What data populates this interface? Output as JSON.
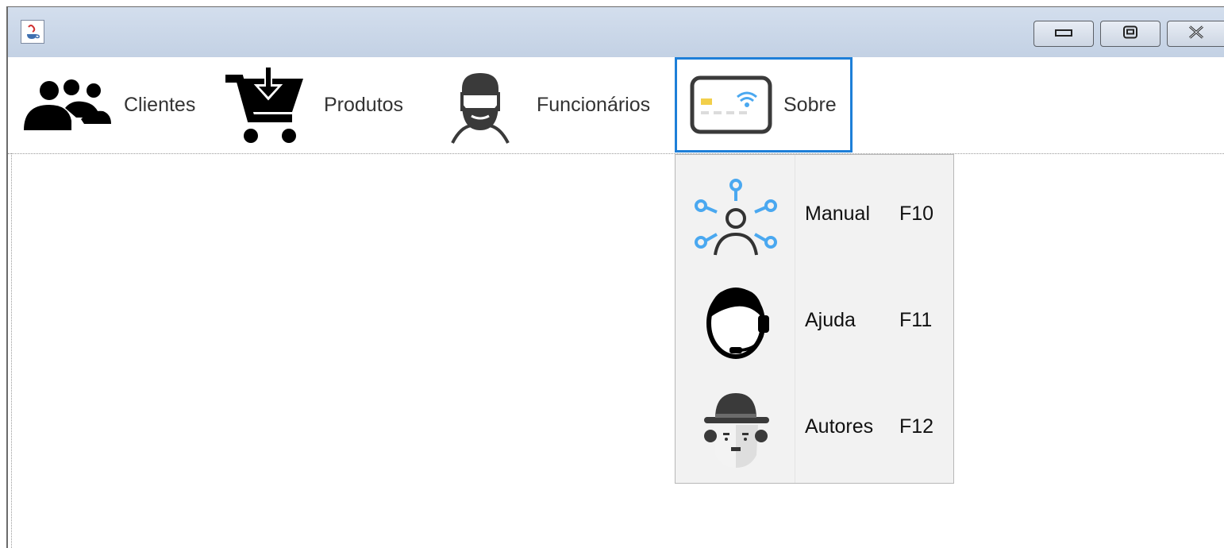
{
  "window": {
    "app_icon": "java-cup-icon",
    "controls": [
      "minimize-icon",
      "maximize-icon",
      "close-icon"
    ]
  },
  "menubar": {
    "items": [
      {
        "label": "Clientes",
        "icon": "users-icon"
      },
      {
        "label": "Produtos",
        "icon": "cart-download-icon"
      },
      {
        "label": "Funcionários",
        "icon": "bearded-man-icon"
      },
      {
        "label": "Sobre",
        "icon": "card-wifi-icon",
        "active": true
      }
    ]
  },
  "dropdown": {
    "items": [
      {
        "label": "Manual",
        "accelerator": "F10",
        "icon": "network-person-icon"
      },
      {
        "label": "Ajuda",
        "accelerator": "F11",
        "icon": "headset-support-icon"
      },
      {
        "label": "Autores",
        "accelerator": "F12",
        "icon": "chaplin-face-icon"
      }
    ]
  },
  "colors": {
    "active_border": "#1e7fd8",
    "titlebar": "#c9d6e8",
    "dropdown_bg": "#f2f2f2",
    "accent_icon": "#4aa8f0"
  }
}
